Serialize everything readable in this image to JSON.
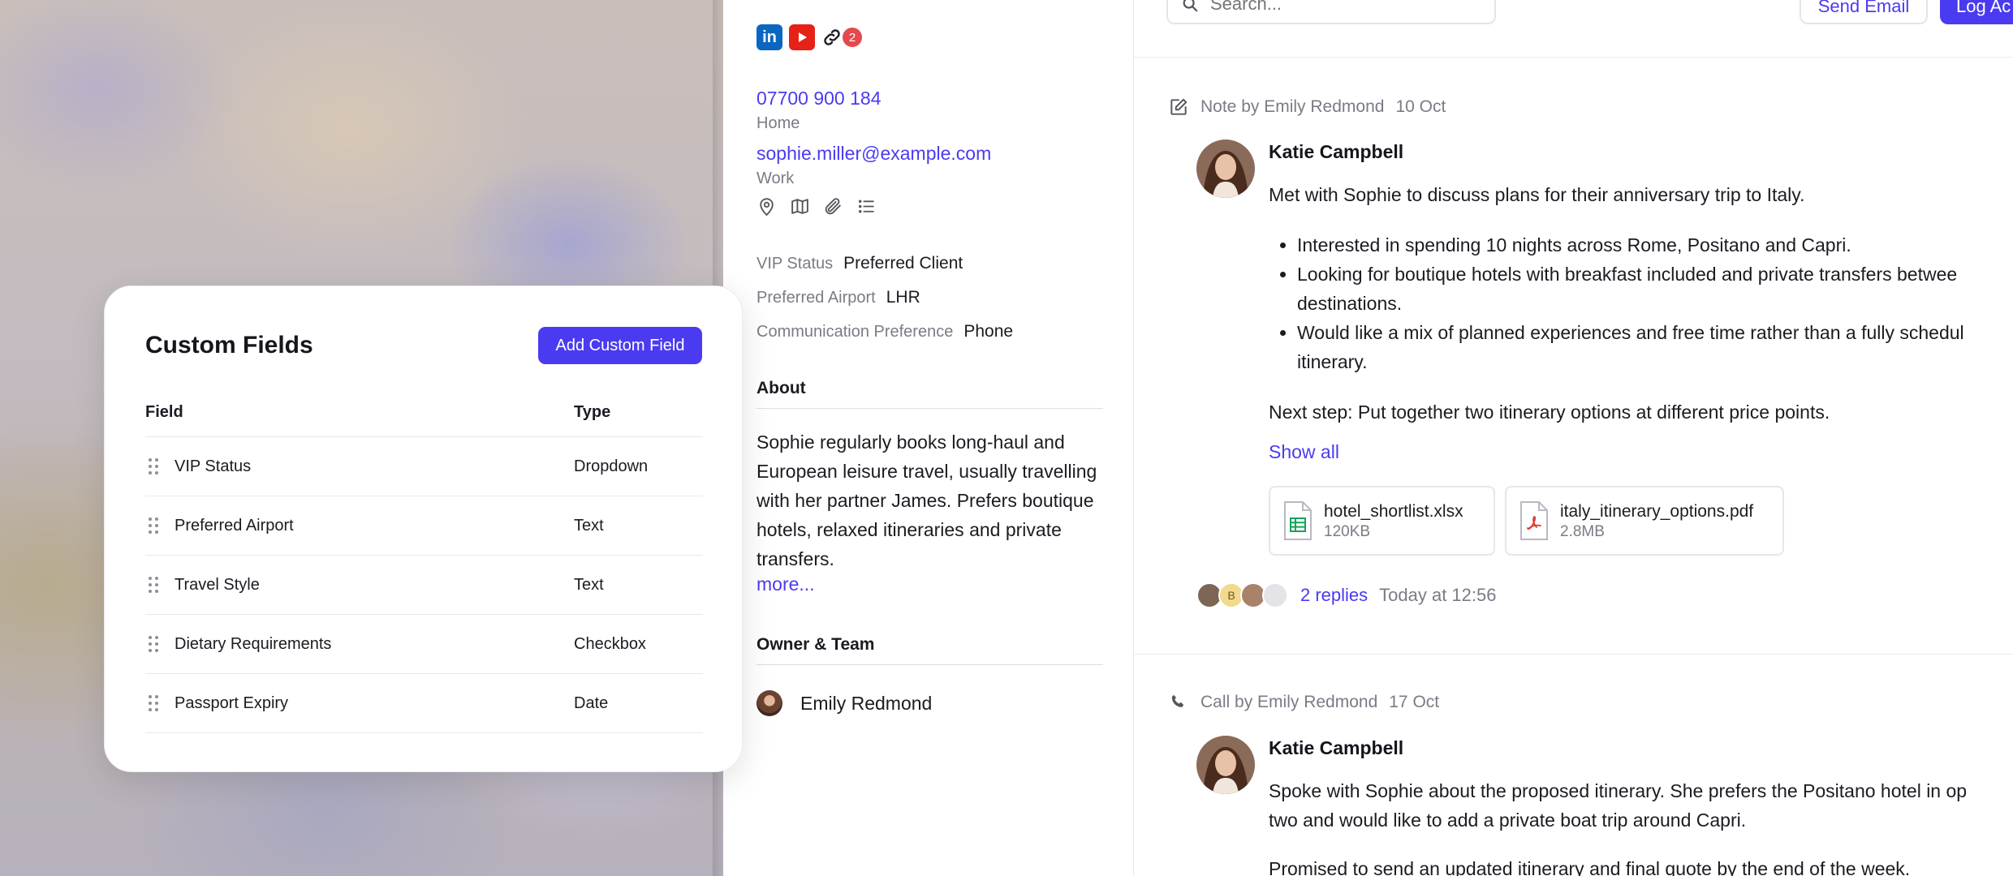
{
  "custom_fields": {
    "title": "Custom Fields",
    "add_button": "Add Custom Field",
    "columns": {
      "field": "Field",
      "type": "Type"
    },
    "rows": [
      {
        "field": "VIP Status",
        "type": "Dropdown"
      },
      {
        "field": "Preferred Airport",
        "type": "Text"
      },
      {
        "field": "Travel Style",
        "type": "Text"
      },
      {
        "field": "Dietary Requirements",
        "type": "Checkbox"
      },
      {
        "field": "Passport Expiry",
        "type": "Date"
      }
    ]
  },
  "contact": {
    "social": {
      "linkedin": "in",
      "links_badge": "2"
    },
    "phone": "07700 900 184",
    "phone_type": "Home",
    "email": "sophie.miller@example.com",
    "email_type": "Work",
    "attributes": [
      {
        "key": "VIP Status",
        "value": "Preferred Client"
      },
      {
        "key": "Preferred Airport",
        "value": "LHR"
      },
      {
        "key": "Communication Preference",
        "value": "Phone"
      }
    ],
    "about_title": "About",
    "about_text": "Sophie regularly books long-haul and European leisure travel, usually travelling with her partner James. Prefers boutique hotels, relaxed itineraries and private transfers.",
    "about_more": "more...",
    "owner_title": "Owner & Team",
    "owner_name": "Emily Redmond"
  },
  "activity": {
    "search_placeholder": "Search...",
    "send_email": "Send Email",
    "log_activity": "Log Ac",
    "note": {
      "header": "Note by Emily Redmond",
      "date": "10 Oct",
      "author": "Katie Campbell",
      "intro": "Met with Sophie to discuss plans for their anniversary trip to Italy.",
      "bullets": [
        "Interested in spending 10 nights across Rome, Positano and Capri.",
        "Looking for boutique hotels with breakfast included and private transfers betwee",
        "destinations.",
        "Would like a mix of planned experiences and free time rather than a fully schedul",
        "itinerary."
      ],
      "next_step": "Next step: Put together two itinerary options at different price points.",
      "show_all": "Show all",
      "files": [
        {
          "name": "hotel_shortlist.xlsx",
          "size": "120KB"
        },
        {
          "name": "italy_itinerary_options.pdf",
          "size": "2.8MB"
        }
      ],
      "reply_avatar_initial": "B",
      "replies": "2 replies",
      "replies_time": "Today at 12:56"
    },
    "call": {
      "header": "Call by Emily Redmond",
      "date": "17 Oct",
      "author": "Katie Campbell",
      "line1": "Spoke with Sophie about the proposed itinerary. She prefers the Positano hotel in op",
      "line2": "two and would like to add a private boat trip around Capri.",
      "line3": "Promised to send an updated itinerary and final quote by the end of the week."
    }
  },
  "colors": {
    "accent": "#4a3bf0",
    "badge": "#e5484d",
    "linkedin": "#0a66c2",
    "youtube": "#e62117"
  }
}
